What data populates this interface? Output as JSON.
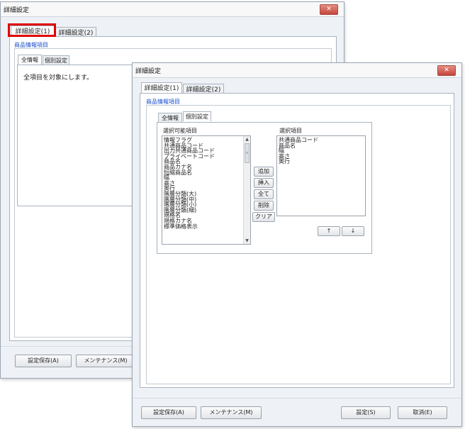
{
  "back_window": {
    "title": "詳細設定",
    "close_label": "✕",
    "tabs": [
      {
        "label": "詳細設定(1)"
      },
      {
        "label": "詳細設定(2)"
      }
    ],
    "section_label": "商品情報項目",
    "inner_tabs": [
      {
        "label": "全情報"
      },
      {
        "label": "個別設定"
      }
    ],
    "message": "全項目を対象にします。",
    "footer_buttons": {
      "save": "設定保存(A)",
      "maintenance": "メンテナンス(M)"
    }
  },
  "front_window": {
    "title": "詳細設定",
    "close_label": "✕",
    "tabs": [
      {
        "label": "詳細設定(1)"
      },
      {
        "label": "詳細設定(2)"
      }
    ],
    "section_label": "商品情報項目",
    "inner_tabs": [
      {
        "label": "全情報"
      },
      {
        "label": "個別設定"
      }
    ],
    "available_label": "選択可能項目",
    "available_items": [
      "情報フラグ",
      "共通商品コード",
      "出力共通商品コード",
      "プライベートコード",
      "商品名",
      "商品カナ名",
      "短縮商品名",
      "幅",
      "高さ",
      "奥行",
      "階層分類(大)",
      "階層分類(中)",
      "階層分類(小)",
      "階層分類(細)",
      "規格名",
      "規格カナ名",
      "標準価格表示"
    ],
    "selected_label": "選択項目",
    "selected_items": [
      "共通商品コード",
      "商品名",
      "幅",
      "高さ",
      "奥行"
    ],
    "middle_buttons": {
      "add": "追加",
      "insert": "挿入",
      "all": "全て",
      "delete": "削除",
      "clear": "クリア"
    },
    "move_buttons": {
      "up": "↑",
      "down": "↓"
    },
    "footer_buttons": {
      "save": "設定保存(A)",
      "maintenance": "メンテナンス(M)",
      "settings": "設定(S)",
      "cancel": "取消(E)"
    }
  }
}
